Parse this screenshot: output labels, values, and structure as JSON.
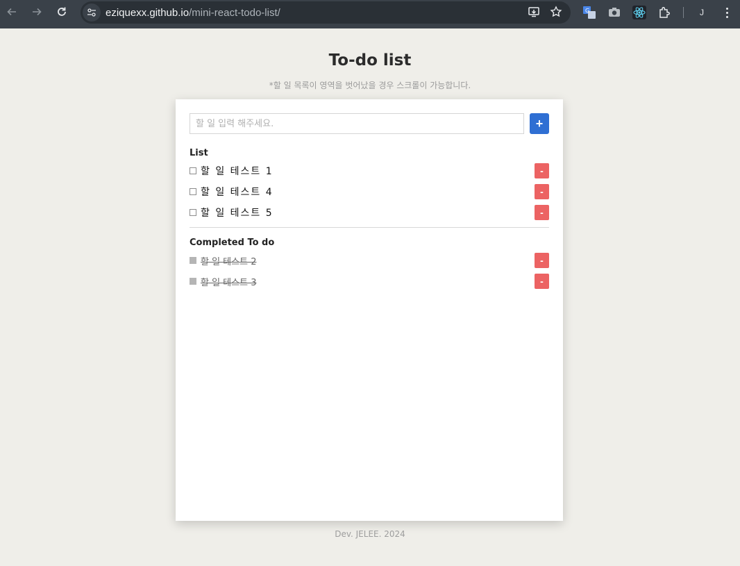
{
  "browser": {
    "url_host": "eziquexx.github.io",
    "url_path": "/mini-react-todo-list/",
    "profile_initial": "J",
    "icons": {
      "back": "arrow-left-icon",
      "forward": "arrow-right-icon",
      "reload": "reload-icon",
      "site_info": "tune-icon",
      "install": "install-app-icon",
      "bookmark": "star-icon",
      "translate": "google-translate-icon",
      "camera": "camera-icon",
      "react": "react-devtools-icon",
      "extensions": "puzzle-icon",
      "menu": "kebab-menu-icon"
    }
  },
  "page": {
    "title": "To-do list",
    "subtitle": "*할 일 목록이 영역을 벗어났을 경우 스크롤이 가능합니다.",
    "footer": "Dev. JELEE. 2024"
  },
  "form": {
    "placeholder": "할 일 입력 해주세요.",
    "value": "",
    "add_label": "+"
  },
  "list": {
    "title": "List",
    "items": [
      {
        "text": "할 일 테스트 1",
        "delete_label": "-",
        "done": false
      },
      {
        "text": "할 일 테스트 4",
        "delete_label": "-",
        "done": false
      },
      {
        "text": "할 일 테스트 5",
        "delete_label": "-",
        "done": false
      }
    ]
  },
  "completed": {
    "title": "Completed To do",
    "items": [
      {
        "text": "할 일 테스트 2",
        "delete_label": "-",
        "done": true
      },
      {
        "text": "할 일 테스트 3",
        "delete_label": "-",
        "done": true
      }
    ]
  },
  "colors": {
    "page_bg": "#efeee9",
    "add_button": "#2f6fd3",
    "delete_button": "#ec6363",
    "chrome_bg": "#3a4149"
  }
}
